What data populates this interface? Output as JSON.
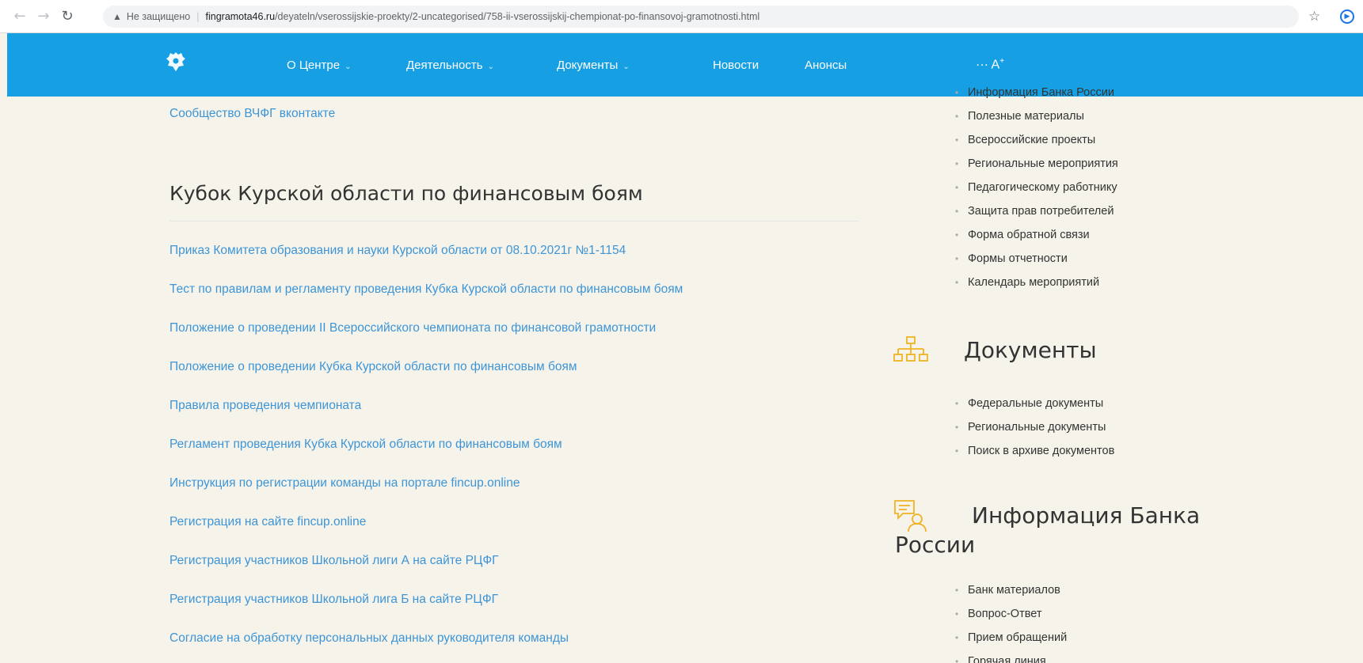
{
  "browser": {
    "insecure_label": "Не защищено",
    "url_host": "fingramota46.ru",
    "url_path": "/deyateln/vserossijskie-proekty/2-uncategorised/758-ii-vserossijskij-chempionat-po-finansovoj-gramotnosti.html"
  },
  "header": {
    "menu": [
      {
        "label": "О Центре",
        "has_dropdown": true
      },
      {
        "label": "Деятельность",
        "has_dropdown": true
      },
      {
        "label": "Документы",
        "has_dropdown": true
      },
      {
        "label": "Новости",
        "has_dropdown": false
      },
      {
        "label": "Анонсы",
        "has_dropdown": false
      }
    ],
    "a11y_label": "··· A",
    "a11y_sup": "+",
    "color": "#169fe3"
  },
  "main": {
    "top_link": "Сообщество ВЧФГ вконтакте",
    "section_title": "Кубок Курской области по финансовым боям",
    "links": [
      "Приказ Комитета образования и науки Курской области от 08.10.2021г №1-1154",
      "Тест по правилам и регламенту проведения Кубка Курской области по финансовым боям",
      "Положение о проведении II Всероссийского чемпионата по финансовой грамотности",
      "Положение о проведении Кубка Курской области по финансовым боям",
      "Правила проведения чемпионата",
      "Регламент проведения Кубка Курской области по финансовым боям",
      "Инструкция по регистрации команды на портале fincup.online",
      "Регистрация на сайте fincup.online",
      "Регистрация участников Школьной лиги А на сайте РЦФГ",
      "Регистрация участников Школьной лига Б на сайте РЦФГ",
      "Согласие на обработку персональных данных руководителя команды"
    ],
    "link_color": "#3d95d7"
  },
  "sidebar": {
    "activity_items": [
      "Информация Банка России",
      "Полезные материалы",
      "Всероссийские проекты",
      "Региональные мероприятия",
      "Педагогическому работнику",
      "Защита прав потребителей",
      "Форма обратной связи",
      "Формы отчетности",
      "Календарь мероприятий"
    ],
    "documents_title": "Документы",
    "documents_items": [
      "Федеральные документы",
      "Региональные документы",
      "Поиск в архиве документов"
    ],
    "bank_title_line1": "Информация Банка",
    "bank_title_line2": "России",
    "bank_items": [
      "Банк материалов",
      "Вопрос-Ответ",
      "Прием обращений",
      "Горячая линия"
    ],
    "icon_color": "#f0b323"
  }
}
